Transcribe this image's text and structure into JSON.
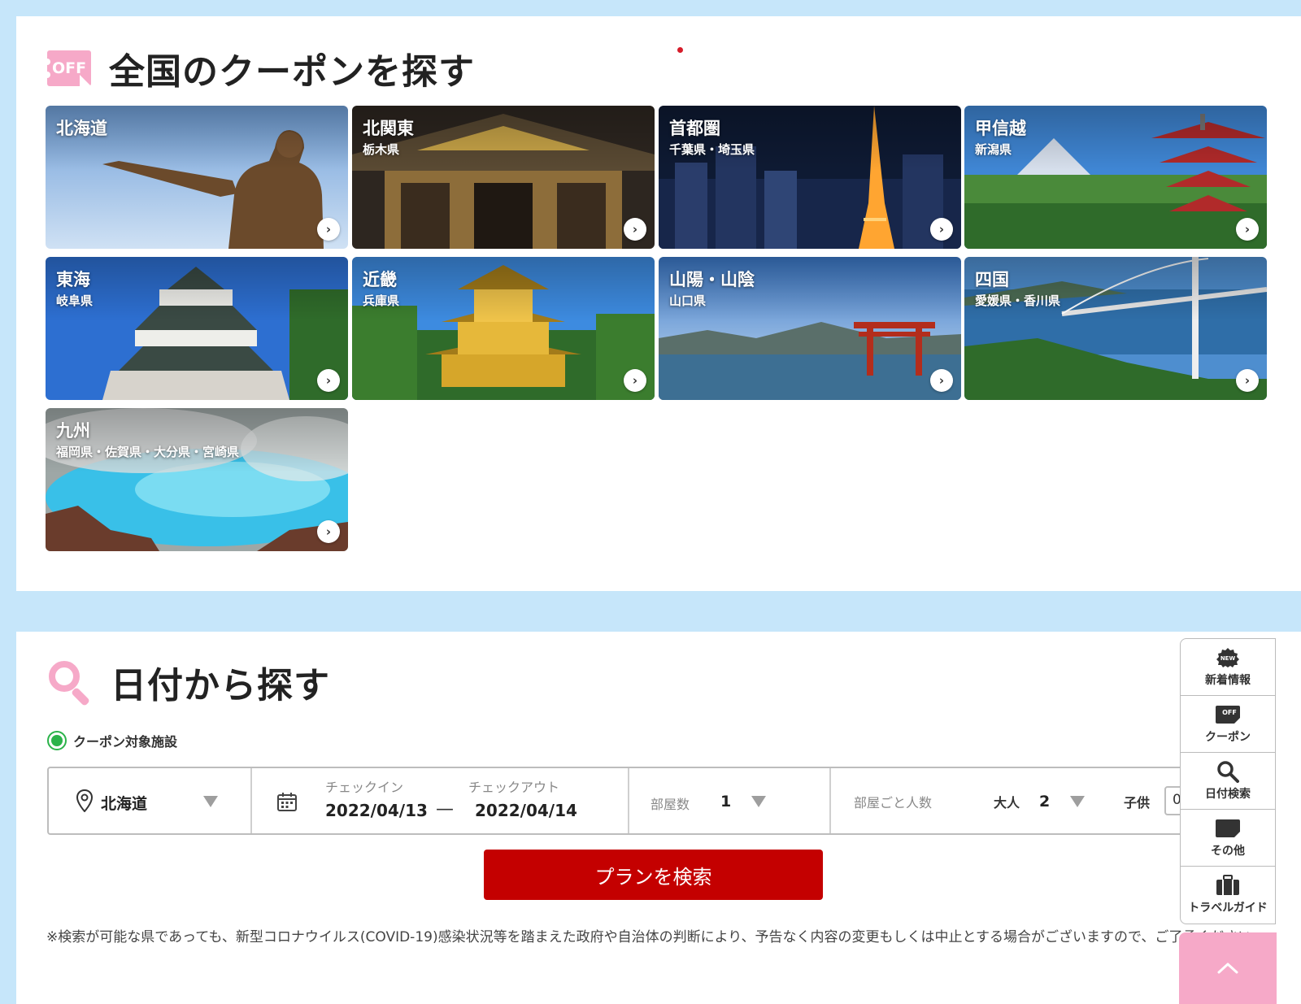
{
  "coupon_section": {
    "badge_text": "OFF",
    "title": "全国のクーポンを探す",
    "regions": [
      {
        "name": "北海道",
        "sub": ""
      },
      {
        "name": "北関東",
        "sub": "栃木県"
      },
      {
        "name": "首都圏",
        "sub": "千葉県・埼玉県"
      },
      {
        "name": "甲信越",
        "sub": "新潟県"
      },
      {
        "name": "東海",
        "sub": "岐阜県"
      },
      {
        "name": "近畿",
        "sub": "兵庫県"
      },
      {
        "name": "山陽・山陰",
        "sub": "山口県"
      },
      {
        "name": "四国",
        "sub": "愛媛県・香川県"
      },
      {
        "name": "九州",
        "sub": "福岡県・佐賀県・大分県・宮崎県"
      }
    ]
  },
  "date_section": {
    "title": "日付から探す",
    "coupon_filter_label": "クーポン対象施設",
    "location_value": "北海道",
    "checkin_label": "チェックイン",
    "checkout_label": "チェックアウト",
    "checkin_value": "2022/04/13",
    "checkout_value": "2022/04/14",
    "date_separator": "—",
    "rooms_label": "部屋数",
    "rooms_value": "1",
    "guests_label": "部屋ごと人数",
    "adults_label": "大人",
    "adults_value": "2",
    "children_label": "子供",
    "children_value": "0",
    "submit_label": "プランを検索",
    "notice": "※検索が可能な県であっても、新型コロナウイルス(COVID-19)感染状況等を踏まえた政府や自治体の判断により、予告なく内容の変更もしくは中止とする場合がございますので、ご了承ください。"
  },
  "side_nav": {
    "new_badge": "NEW",
    "items": [
      {
        "label": "新着情報",
        "icon": "new-badge-icon"
      },
      {
        "label": "クーポン",
        "icon": "coupon-icon"
      },
      {
        "label": "日付検索",
        "icon": "search-icon"
      },
      {
        "label": "その他",
        "icon": "other-icon"
      },
      {
        "label": "トラベルガイド",
        "icon": "luggage-icon"
      }
    ]
  },
  "colors": {
    "page_bg": "#c6e6fa",
    "accent_pink": "#f6a9c8",
    "submit_red": "#c40000",
    "radio_green": "#2bb34a"
  }
}
